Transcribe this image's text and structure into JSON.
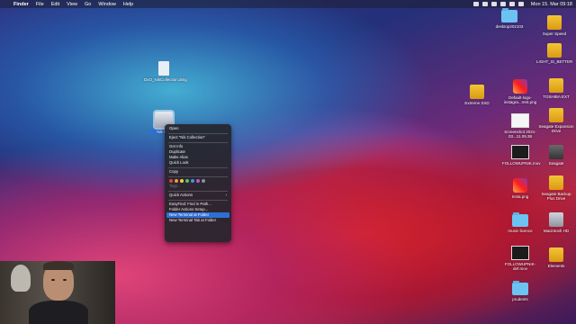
{
  "menubar": {
    "app": "Finder",
    "items": [
      "File",
      "Edit",
      "View",
      "Go",
      "Window",
      "Help"
    ],
    "clock": "Mon 15. Mar 09:18"
  },
  "desktop_left": [
    {
      "label": "DxO_NikCollection.dmg",
      "icon": "dmg-file-icon"
    },
    {
      "label": "Nik Coll",
      "icon": "mounted-disk-icon"
    }
  ],
  "desktop_right": [
    {
      "label": "desktop202103",
      "icon": "folder-icon"
    },
    {
      "label": "Super Speed",
      "icon": "drive-icon"
    },
    {
      "label": "LIGHT_IS_BETTER",
      "icon": "drive-icon"
    },
    {
      "label": "Extreme SSD",
      "icon": "drive-icon"
    },
    {
      "label": "Default-logo-instagra...rent.png",
      "icon": "image-icon"
    },
    {
      "label": "TOSHIBA EXT",
      "icon": "drive-icon"
    },
    {
      "label": "Seagate Expansion Drive",
      "icon": "drive-icon"
    },
    {
      "label": "Screenshot 2021-03...11.09.38",
      "icon": "screenshot-icon"
    },
    {
      "label": "FOLLOWUPNIK.mov",
      "icon": "video-icon"
    },
    {
      "label": "Seagate",
      "icon": "drive-icon"
    },
    {
      "label": "Insta.png",
      "icon": "image-icon"
    },
    {
      "label": "Seagate Backup Plus Drive",
      "icon": "drive-icon"
    },
    {
      "label": "music-licence",
      "icon": "folder-icon"
    },
    {
      "label": "Macintosh HD",
      "icon": "drive-icon"
    },
    {
      "label": "FOLLOWUPNIK-def.mov",
      "icon": "video-icon"
    },
    {
      "label": "Elements",
      "icon": "drive-icon"
    },
    {
      "label": "prudents",
      "icon": "folder-icon"
    }
  ],
  "context_menu": {
    "open": "Open",
    "eject": "Eject \"Nik Collection\"",
    "get_info": "Get Info",
    "duplicate": "Duplicate",
    "make_alias": "Make Alias",
    "quick_look": "Quick Look",
    "copy": "Copy",
    "tag_colors": [
      "#e0443c",
      "#f19a38",
      "#f4d03f",
      "#5ac05a",
      "#4a90e2",
      "#a65fd6",
      "#8e8e93"
    ],
    "tags": "Tags...",
    "quick_actions": "Quick Actions",
    "easyfind": "EasyFind: Find in Path...",
    "folder_actions": "Folder Actions Setup...",
    "new_terminal": "New Terminal at Folder",
    "new_terminal_tab": "New Terminal Tab at Folder"
  }
}
